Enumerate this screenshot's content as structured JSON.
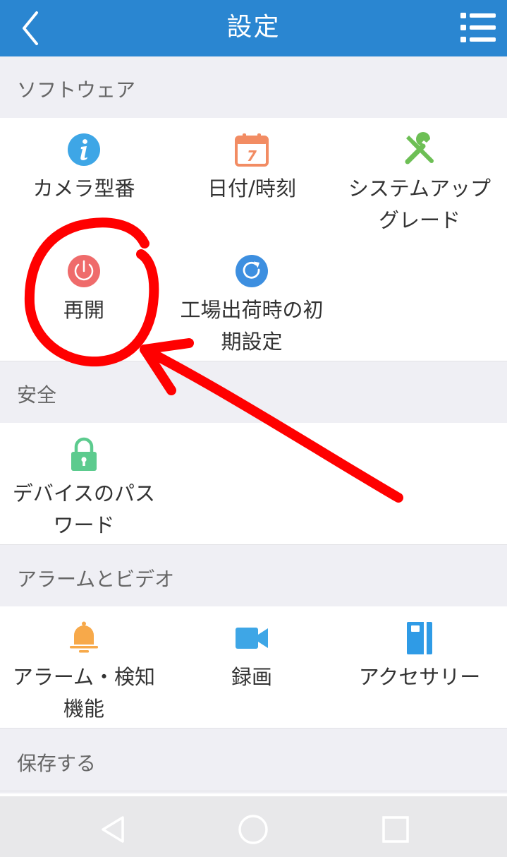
{
  "header": {
    "title": "設定"
  },
  "sections": {
    "software": {
      "title": "ソフトウェア",
      "items": [
        {
          "label": "カメラ型番",
          "icon": "info-icon"
        },
        {
          "label": "日付/時刻",
          "icon": "calendar-icon",
          "icon_text": "7"
        },
        {
          "label": "システムアップグレード",
          "icon": "tools-icon"
        },
        {
          "label": "再開",
          "icon": "power-icon"
        },
        {
          "label": "工場出荷時の初期設定",
          "icon": "reset-icon"
        }
      ]
    },
    "security": {
      "title": "安全",
      "items": [
        {
          "label": "デバイスのパスワード",
          "icon": "lock-icon"
        }
      ]
    },
    "alarm": {
      "title": "アラームとビデオ",
      "items": [
        {
          "label": "アラーム・検知機能",
          "icon": "bell-icon"
        },
        {
          "label": "録画",
          "icon": "video-camera-icon"
        },
        {
          "label": "アクセサリー",
          "icon": "accessory-icon"
        }
      ]
    },
    "storage": {
      "title": "保存する"
    }
  },
  "colors": {
    "header_bg": "#2a86d1",
    "info": "#3ea6e6",
    "calendar": "#f28c63",
    "tools": "#6dbf55",
    "power": "#ef6b6b",
    "reset": "#3d8fe0",
    "lock": "#5ccb8e",
    "bell": "#f7a94a",
    "video": "#3ea6e6",
    "accessory": "#2f9be6",
    "annotation": "#ff0000"
  }
}
